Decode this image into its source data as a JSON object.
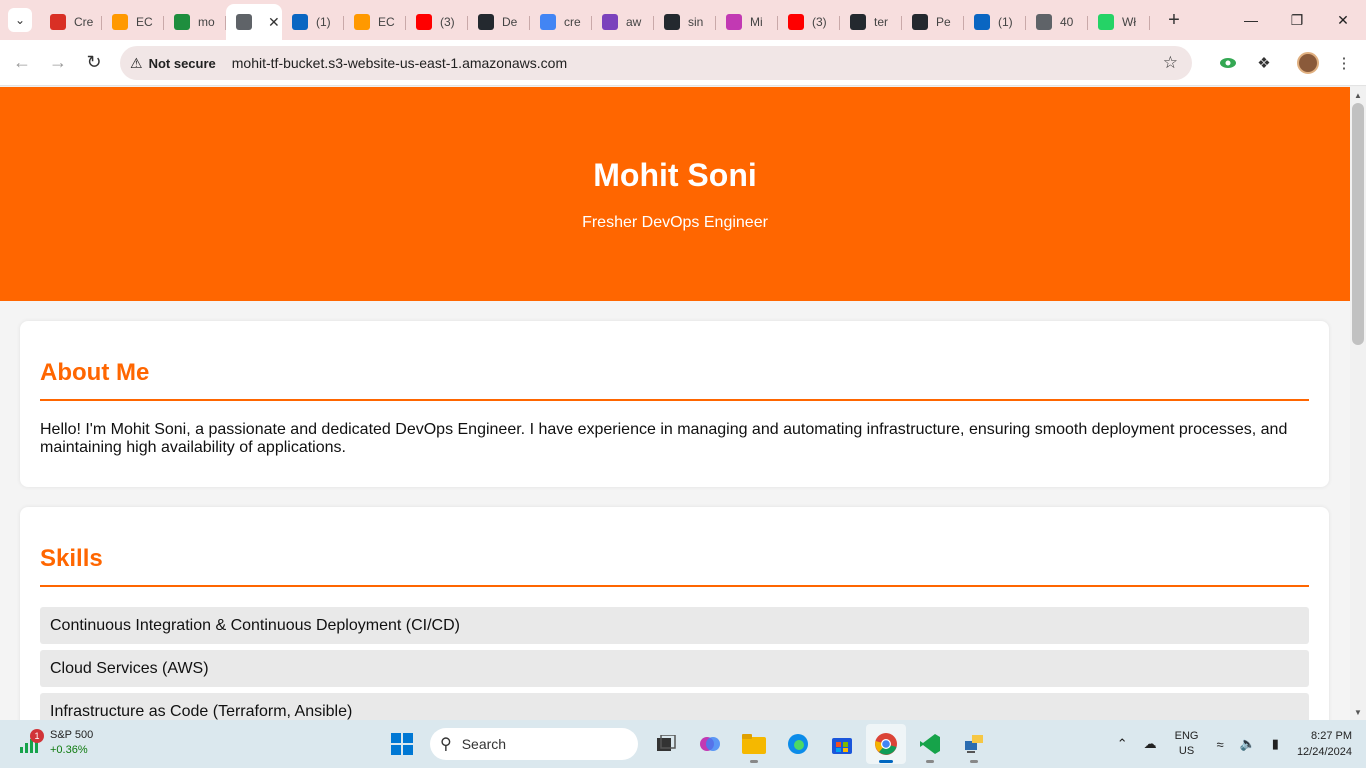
{
  "tabs": [
    {
      "label": "Cre",
      "icon": "mail-icon",
      "color": "#d93025"
    },
    {
      "label": "EC",
      "icon": "aws-ec2-icon",
      "color": "#ff9900"
    },
    {
      "label": "mo",
      "icon": "terminal-icon",
      "color": "#1e8e3e"
    },
    {
      "label": "",
      "icon": "globe-icon",
      "color": "#5f6368",
      "active": true
    },
    {
      "label": "(1)",
      "icon": "linkedin-icon",
      "color": "#0a66c2"
    },
    {
      "label": "EC",
      "icon": "aws-ec2-icon",
      "color": "#ff9900"
    },
    {
      "label": "(3)",
      "icon": "youtube-icon",
      "color": "#ff0000"
    },
    {
      "label": "De",
      "icon": "github-icon",
      "color": "#24292f"
    },
    {
      "label": "cre",
      "icon": "google-icon",
      "color": "#4285f4"
    },
    {
      "label": "aw",
      "icon": "terraform-icon",
      "color": "#7b42bc"
    },
    {
      "label": "sin",
      "icon": "github-icon",
      "color": "#24292f"
    },
    {
      "label": "Mi",
      "icon": "copilot-icon",
      "color": "#c239b3"
    },
    {
      "label": "(3)",
      "icon": "youtube-icon",
      "color": "#ff0000"
    },
    {
      "label": "ter",
      "icon": "github-icon",
      "color": "#24292f"
    },
    {
      "label": "Pe",
      "icon": "github-icon",
      "color": "#24292f"
    },
    {
      "label": "(1)",
      "icon": "linkedin-icon",
      "color": "#0a66c2"
    },
    {
      "label": "40",
      "icon": "globe-icon",
      "color": "#5f6368"
    },
    {
      "label": "Wł",
      "icon": "whatsapp-icon",
      "color": "#25d366"
    }
  ],
  "toolbar": {
    "security_label": "Not secure",
    "url": "mohit-tf-bucket.s3-website-us-east-1.amazonaws.com"
  },
  "page": {
    "name": "Mohit Soni",
    "subtitle": "Fresher DevOps Engineer",
    "about": {
      "heading": "About Me",
      "text": "Hello! I'm Mohit Soni, a passionate and dedicated DevOps Engineer. I have experience in managing and automating infrastructure, ensuring smooth deployment processes, and maintaining high availability of applications."
    },
    "skills": {
      "heading": "Skills",
      "items": [
        "Continuous Integration & Continuous Deployment (CI/CD)",
        "Cloud Services (AWS)",
        "Infrastructure as Code (Terraform, Ansible)"
      ]
    },
    "accent_color": "#ff6600"
  },
  "taskbar": {
    "widget_title": "S&P 500",
    "widget_change": "+0.36%",
    "widget_badge": "1",
    "search_label": "Search",
    "lang_line1": "ENG",
    "lang_line2": "US",
    "time": "8:27 PM",
    "date": "12/24/2024"
  }
}
